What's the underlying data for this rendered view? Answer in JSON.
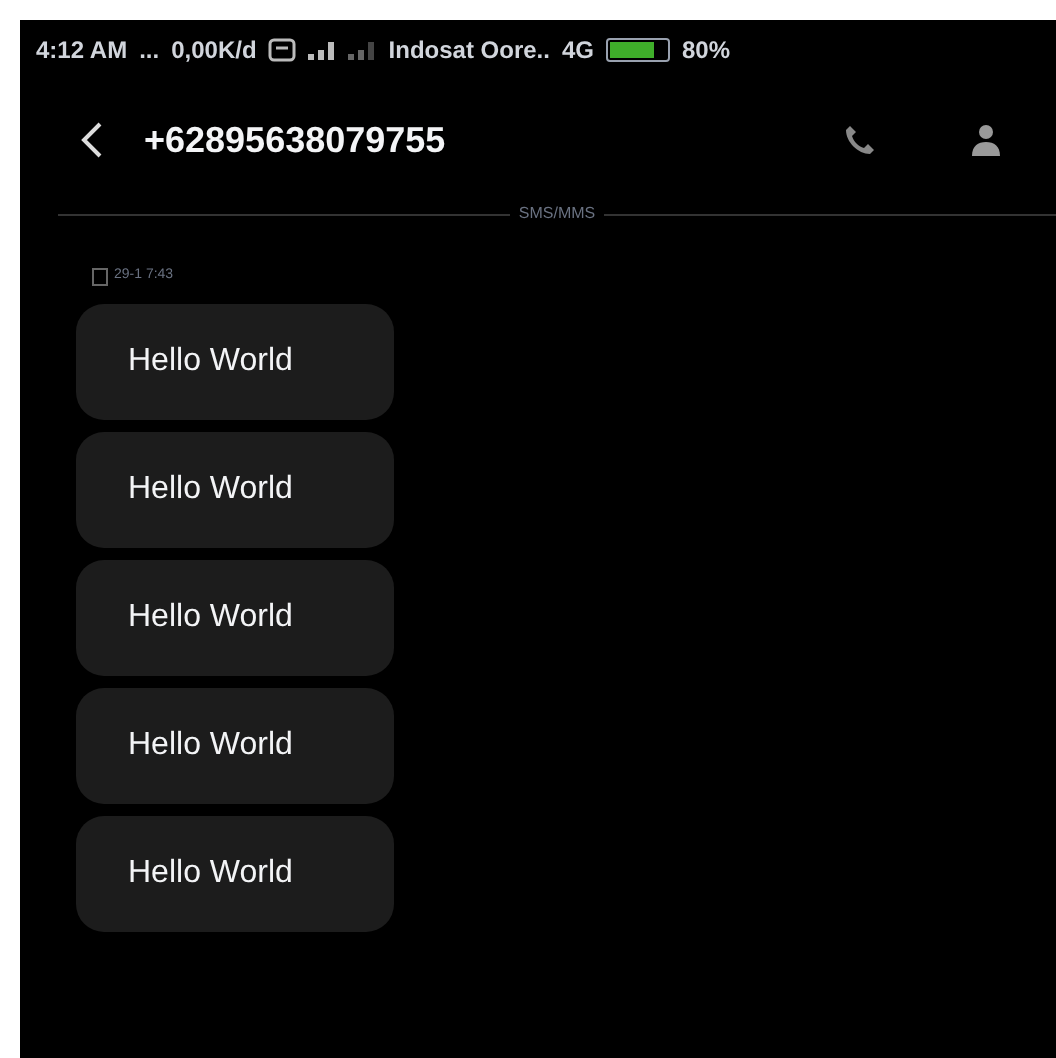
{
  "status_bar": {
    "time": "4:12 AM",
    "dots": "...",
    "speed": "0,00K/d",
    "carrier": "Indosat Oore..",
    "network": "4G",
    "battery": {
      "text": "80%",
      "level": 0.8
    }
  },
  "header": {
    "title": "+62895638079755"
  },
  "divider_label": "SMS/MMS",
  "timestamp": "29-1 7:43",
  "messages": [
    {
      "text": "Hello World"
    },
    {
      "text": "Hello World"
    },
    {
      "text": "Hello World"
    },
    {
      "text": "Hello World"
    },
    {
      "text": "Hello World"
    }
  ]
}
